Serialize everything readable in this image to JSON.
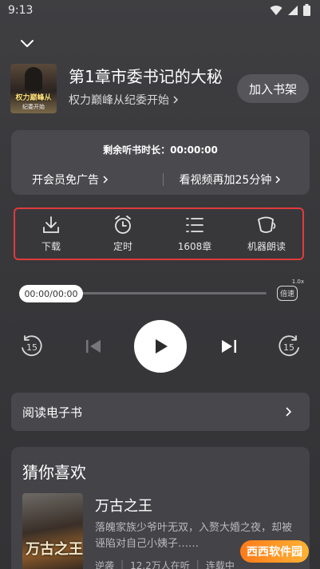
{
  "status_bar": {
    "time": "9:13"
  },
  "book": {
    "cover_text": "权力巅峰从",
    "cover_sub": "纪委开始",
    "chapter_title": "第1章市委书记的大秘",
    "book_name": "权力巅峰从纪委开始",
    "add_to_shelf": "加入书架"
  },
  "timer": {
    "remaining": "剩余听书时长：00:00:00",
    "vip_link": "开会员免广告",
    "video_link": "看视频再加25分钟"
  },
  "tools": [
    {
      "label": "下载",
      "icon": "download-icon"
    },
    {
      "label": "定时",
      "icon": "alarm-icon"
    },
    {
      "label": "1608章",
      "icon": "list-icon"
    },
    {
      "label": "机器朗读",
      "icon": "voice-icon"
    }
  ],
  "player": {
    "time": "00:00/00:00",
    "speed_badge": "1.0x",
    "speed_label": "倍速",
    "rewind": "15",
    "forward": "15",
    "progress": 0
  },
  "ebook": {
    "label": "阅读电子书"
  },
  "recommend": {
    "title": "猜你喜欢",
    "book_title": "万古之王",
    "cover_text": "万古之王",
    "desc": "落魄家族少爷叶无双，入赘大婚之夜，却被诬陷对自己小姨子……",
    "meta": [
      "逆袭",
      "12.2万人在听",
      "连载中"
    ]
  },
  "watermark": "西西软件园"
}
